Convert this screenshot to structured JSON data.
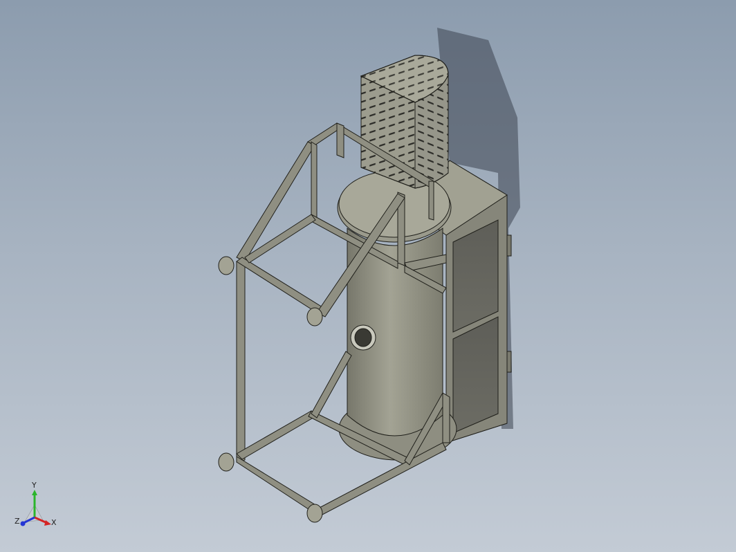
{
  "viewport": {
    "background_top": "#8c9cae",
    "background_bottom": "#c3cbd5",
    "model_fill": "#8f8f82",
    "model_shade": "#6f6f64",
    "edge_color": "#1f1f1a",
    "shadow_color": "#3d4450"
  },
  "triad": {
    "y_label": "Y",
    "x_label": "X",
    "z_label": "Z",
    "y_color": "#2bb52b",
    "x_color": "#d42424",
    "z_color": "#2436d4"
  }
}
